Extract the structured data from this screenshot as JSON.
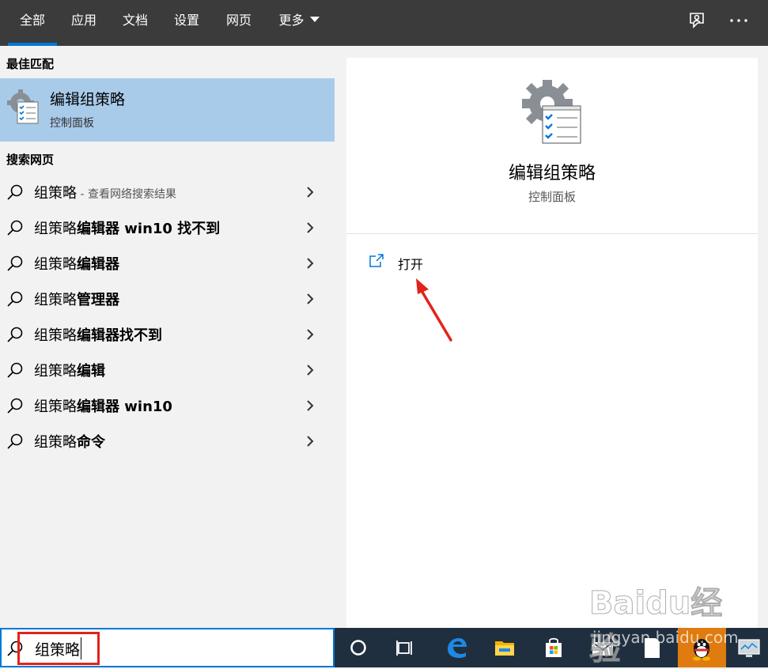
{
  "tabs": [
    {
      "label": "全部",
      "active": true
    },
    {
      "label": "应用"
    },
    {
      "label": "文档"
    },
    {
      "label": "设置"
    },
    {
      "label": "网页"
    },
    {
      "label": "更多"
    }
  ],
  "top_icons": [
    "feedback-icon",
    "more-options-icon"
  ],
  "best_match": {
    "header": "最佳匹配",
    "title": "编辑组策略",
    "subtitle": "控制面板",
    "icon": "group-policy-icon"
  },
  "web_search": {
    "header": "搜索网页",
    "items": [
      {
        "prefix": "组策略",
        "bold": "",
        "hint": " - 查看网络搜索结果"
      },
      {
        "prefix": "组策略",
        "bold": "编辑器 win10 找不到",
        "hint": ""
      },
      {
        "prefix": "组策略",
        "bold": "编辑器",
        "hint": ""
      },
      {
        "prefix": "组策略",
        "bold": "管理器",
        "hint": ""
      },
      {
        "prefix": "组策略",
        "bold": "编辑器找不到",
        "hint": ""
      },
      {
        "prefix": "组策略",
        "bold": "编辑",
        "hint": ""
      },
      {
        "prefix": "组策略",
        "bold": "编辑器 win10",
        "hint": ""
      },
      {
        "prefix": "组策略",
        "bold": "命令",
        "hint": ""
      }
    ]
  },
  "detail": {
    "title": "编辑组策略",
    "subtitle": "控制面板",
    "open_label": "打开"
  },
  "search": {
    "value": "组策略"
  },
  "taskbar": {
    "icons": [
      "cortana-icon",
      "task-view-icon",
      "edge-icon",
      "file-explorer-icon",
      "store-icon",
      "mail-icon",
      "document-icon",
      "qq-icon",
      "monitor-icon"
    ]
  },
  "watermark": {
    "brand": "Baidu经验",
    "url": "jingyan.baidu.com"
  },
  "colors": {
    "accent": "#0078d7",
    "selected_bg": "#a9cbea",
    "topbar_bg": "#3b3b3b",
    "annotation_red": "#e2231a"
  }
}
